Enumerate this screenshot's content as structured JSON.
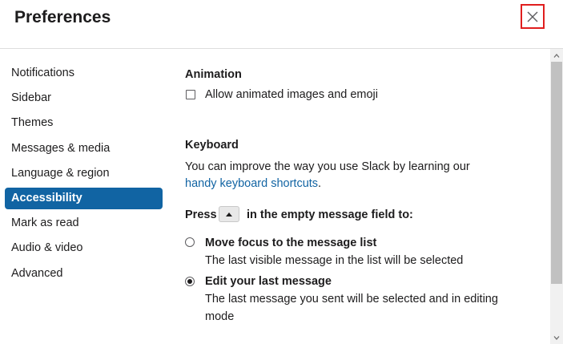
{
  "header": {
    "title": "Preferences",
    "close_icon": "close-icon"
  },
  "sidebar": {
    "items": [
      {
        "label": "Notifications",
        "active": false
      },
      {
        "label": "Sidebar",
        "active": false
      },
      {
        "label": "Themes",
        "active": false
      },
      {
        "label": "Messages & media",
        "active": false
      },
      {
        "label": "Language & region",
        "active": false
      },
      {
        "label": "Accessibility",
        "active": true
      },
      {
        "label": "Mark as read",
        "active": false
      },
      {
        "label": "Audio & video",
        "active": false
      },
      {
        "label": "Advanced",
        "active": false
      }
    ]
  },
  "animation": {
    "title": "Animation",
    "checkbox_label": "Allow animated images and emoji",
    "checked": false
  },
  "keyboard": {
    "title": "Keyboard",
    "description": "You can improve the way you use Slack by learning our",
    "link": "handy keyboard shortcuts",
    "link_suffix": ".",
    "press_label": "Press",
    "press_key_icon": "up-arrow-key-icon",
    "press_suffix": "in the empty message field to:",
    "options": [
      {
        "label": "Move focus to the message list",
        "description": "The last visible message in the list will be selected",
        "checked": false
      },
      {
        "label": "Edit your last message",
        "description_line1": "The last message you sent will be selected and in editing",
        "description_line2": "mode",
        "checked": true
      }
    ]
  },
  "colors": {
    "accent": "#1164a3",
    "link": "#1264a3",
    "close_highlight": "#e01e1e"
  }
}
